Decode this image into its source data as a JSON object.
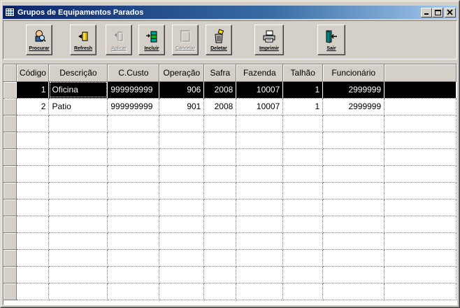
{
  "window": {
    "title": "Grupos de Equipamentos Parados"
  },
  "toolbar": {
    "buttons": [
      {
        "label": "Procurar",
        "icon": "search-person-icon",
        "enabled": true
      },
      {
        "label": "Refresh",
        "icon": "refresh-icon",
        "enabled": true
      },
      {
        "label": "Aplicar",
        "icon": "apply-icon",
        "enabled": false
      },
      {
        "label": "Incluir",
        "icon": "insert-icon",
        "enabled": true
      },
      {
        "label": "Cancelar",
        "icon": "cancel-icon",
        "enabled": false
      },
      {
        "label": "Deletar",
        "icon": "delete-icon",
        "enabled": true
      },
      {
        "label": "Imprimir",
        "icon": "printer-icon",
        "enabled": true
      },
      {
        "label": "Sair",
        "icon": "exit-door-icon",
        "enabled": true
      }
    ]
  },
  "grid": {
    "columns": [
      "Código",
      "Descrição",
      "C.Custo",
      "Operação",
      "Safra",
      "Fazenda",
      "Talhão",
      "Funcionário"
    ],
    "rows": [
      [
        "1",
        "Oficina",
        "999999999",
        "906",
        "2008",
        "10007",
        "1",
        "2999999"
      ],
      [
        "2",
        "Patio",
        "999999999",
        "901",
        "2008",
        "10007",
        "1",
        "2999999"
      ]
    ],
    "selected_row": 0
  },
  "colors": {
    "title_bar": "#0a246a",
    "selection": "#000000",
    "face": "#d4d0c8"
  }
}
